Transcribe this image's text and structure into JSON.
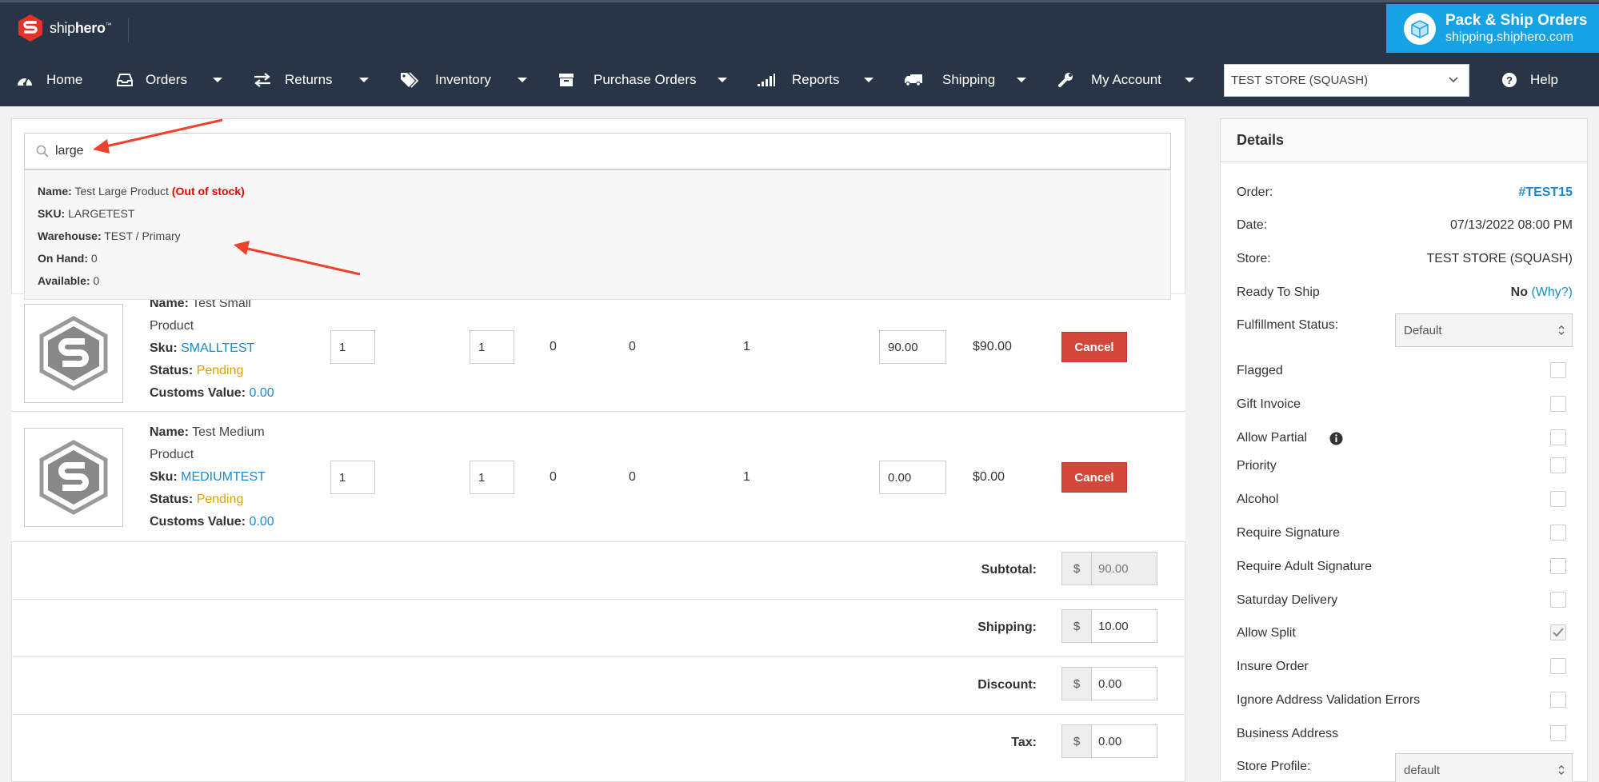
{
  "brand": {
    "logo_text_light": "ship",
    "logo_text_bold": "hero",
    "tm": "™"
  },
  "promo": {
    "title": "Pack & Ship Orders",
    "url": "shipping.shiphero.com"
  },
  "nav": {
    "home": "Home",
    "orders": "Orders",
    "returns": "Returns",
    "inventory": "Inventory",
    "purchase_orders": "Purchase Orders",
    "reports": "Reports",
    "shipping": "Shipping",
    "my_account": "My Account",
    "store_select": "TEST STORE (SQUASH)",
    "help": "Help"
  },
  "search": {
    "value": "large",
    "result": {
      "name_label": "Name:",
      "name": "Test Large Product",
      "stock_flag": "(Out of stock)",
      "sku_label": "SKU:",
      "sku": "LARGETEST",
      "warehouse_label": "Warehouse:",
      "warehouse": "TEST / Primary",
      "on_hand_label": "On Hand:",
      "on_hand": "0",
      "available_label": "Available:",
      "available": "0"
    }
  },
  "items": [
    {
      "name_label": "Name:",
      "name": "Test Small Product",
      "sku_label": "Sku:",
      "sku": "SMALLTEST",
      "status_label": "Status:",
      "status": "Pending",
      "customs_label": "Customs Value:",
      "customs": "0.00",
      "qty": "1",
      "qty2": "1",
      "c1": "0",
      "c2": "0",
      "c3": "1",
      "price": "90.00",
      "total": "$90.00",
      "cancel": "Cancel"
    },
    {
      "name_label": "Name:",
      "name": "Test Medium Product",
      "sku_label": "Sku:",
      "sku": "MEDIUMTEST",
      "status_label": "Status:",
      "status": "Pending",
      "customs_label": "Customs Value:",
      "customs": "0.00",
      "qty": "1",
      "qty2": "1",
      "c1": "0",
      "c2": "0",
      "c3": "1",
      "price": "0.00",
      "total": "$0.00",
      "cancel": "Cancel"
    }
  ],
  "totals": {
    "currency": "$",
    "subtotal_label": "Subtotal:",
    "subtotal": "90.00",
    "shipping_label": "Shipping:",
    "shipping": "10.00",
    "discount_label": "Discount:",
    "discount": "0.00",
    "tax_label": "Tax:",
    "tax": "0.00"
  },
  "details": {
    "title": "Details",
    "order_label": "Order:",
    "order": "#TEST15",
    "date_label": "Date:",
    "date": "07/13/2022 08:00 PM",
    "store_label": "Store:",
    "store": "TEST STORE (SQUASH)",
    "ready_label": "Ready To Ship",
    "ready": "No",
    "why": "(Why?)",
    "fulfillment_label": "Fulfillment Status:",
    "fulfillment": "Default",
    "flags": [
      {
        "label": "Flagged",
        "checked": false
      },
      {
        "label": "Gift Invoice",
        "checked": false
      },
      {
        "label": "Allow Partial",
        "checked": false
      },
      {
        "label": "Priority",
        "checked": false
      },
      {
        "label": "Alcohol",
        "checked": false
      },
      {
        "label": "Require Signature",
        "checked": false
      },
      {
        "label": "Require Adult Signature",
        "checked": false
      },
      {
        "label": "Saturday Delivery",
        "checked": false
      },
      {
        "label": "Allow Split",
        "checked": true
      },
      {
        "label": "Insure Order",
        "checked": false
      },
      {
        "label": "Ignore Address Validation Errors",
        "checked": false
      },
      {
        "label": "Business Address",
        "checked": false
      }
    ],
    "store_profile_label": "Store Profile:",
    "store_profile": "default"
  },
  "colors": {
    "navbar": "#283546",
    "promo": "#15a3e6",
    "link": "#1a8ad0",
    "pending": "#e0a000",
    "cancel": "#d2483b",
    "arrow": "#f0412a"
  }
}
